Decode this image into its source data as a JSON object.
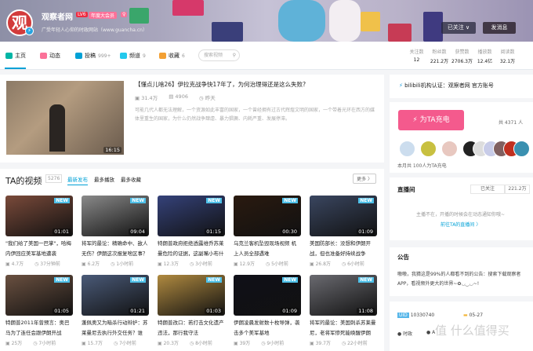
{
  "header": {
    "username": "观察者网",
    "level": "LV6",
    "vip": "年度大会员",
    "sex_badge": "♀",
    "signature": "广受年轻人心仰的时政网站（www.guancha.cn）",
    "follow_button": "已关注 ∨",
    "message_button": "发消息",
    "stats": [
      {
        "label": "关注数",
        "value": "12"
      },
      {
        "label": "粉丝数",
        "value": "221.2万"
      },
      {
        "label": "获赞数",
        "value": "2706.3万"
      },
      {
        "label": "播放数",
        "value": "12.4亿"
      },
      {
        "label": "阅读数",
        "value": "32.1万"
      }
    ]
  },
  "nav": {
    "items": [
      {
        "label": "主页",
        "count": "",
        "icon": "home-icon",
        "color": "#00b5a5"
      },
      {
        "label": "动态",
        "count": "",
        "icon": "dynamic-icon",
        "color": "#fb7299"
      },
      {
        "label": "投稿",
        "count": "999+",
        "icon": "video-icon",
        "color": "#00a1d6"
      },
      {
        "label": "频道",
        "count": "9",
        "icon": "channel-icon",
        "color": "#23c9ed"
      },
      {
        "label": "收藏",
        "count": "6",
        "icon": "favorite-icon",
        "color": "#f3a034"
      }
    ],
    "search_placeholder": "搜索视频"
  },
  "featured": {
    "title": "【懂点儿啥26】伊拉克战争快17年了，为何治理得还是这么失败?",
    "plays": "31.4万",
    "comments": "4906",
    "time": "昨天",
    "duration": "16:15",
    "description": "可能几代人都无法理解，一个资源如此丰富的国家，一个曾经拥有过古代辉煌文明的国家，一个带着光环在西方的媒体里重生的国家，为什么仍然战争肆虐、暴力猖獗、内耗严重、发展停滞。"
  },
  "videos": {
    "title": "TA的视频",
    "count": "5276",
    "tabs": [
      "最新发布",
      "最多播放",
      "最多收藏"
    ],
    "more": "更多 〉",
    "new_label": "NEW",
    "items": [
      {
        "title": "\"我们给了美国一巴掌\"，哈梅内伊回应美军基地遭袭",
        "plays": "4.7万",
        "time": "37分钟前",
        "duration": "01:01",
        "color": "#7a4a3a"
      },
      {
        "title": "将军的最论：精确命中、敌人无伤？伊朗这次报复啥区事？",
        "plays": "6.2万",
        "time": "1小时前",
        "duration": "09:04",
        "color": "#8a8a8a"
      },
      {
        "title": "特朗普政府拒绝透露维乔苏莱曼危险的证据，这副嘴小布什也",
        "plays": "12.3万",
        "time": "3小时前",
        "duration": "01:15",
        "color": "#35427a"
      },
      {
        "title": "乌克兰客机坠毁现场视频 机上人员全部遇难",
        "plays": "12.9万",
        "time": "5小时前",
        "duration": "00:30",
        "color": "#2a1a10"
      },
      {
        "title": "美国防部长：没想和伊朗开战，但也准备好持续战争",
        "plays": "26.8万",
        "time": "6小时前",
        "duration": "01:09",
        "color": "#3a4660"
      },
      {
        "title": "特朗普2011年曾预言：奥巴马为了连任会跟伊朗开战",
        "plays": "25万",
        "time": "7小时前",
        "duration": "01:05",
        "color": "#6a5040"
      },
      {
        "title": "蓬佩奥又为暗杀行动辩护：苏莱曼尼去执行外交任务？谁",
        "plays": "15.7万",
        "time": "7小时前",
        "duration": "01:21",
        "color": "#4a5a78"
      },
      {
        "title": "特朗普改口：若打击文化遗产违法，那行我守法",
        "plays": "20.3万",
        "time": "8小时前",
        "duration": "01:03",
        "color": "#b08a40"
      },
      {
        "title": "伊朗凌晨发射数十枚导弹，袭击多个美军基地",
        "plays": "39万",
        "time": "9小时前",
        "duration": "01:09",
        "color": "#101018"
      },
      {
        "title": "将军的最论：美国刺杀苏莱曼尼，老将军惨死能唤醒伊朗",
        "plays": "39.7万",
        "time": "22小时前",
        "duration": "11:08",
        "color": "#6a6a70"
      }
    ]
  },
  "sidebar": {
    "certification": "bilibili机构认证：观察者网 官方账号",
    "charge_button": "为TA充电",
    "charge_total": "共 4371 人",
    "charge_month": "本月共 100人为TA充电",
    "live": {
      "title": "直播间",
      "followed": "已关注",
      "fans": "221.2万",
      "offline": "主播不在，开播的时候会在动态通知你哦~",
      "link": "前往TA的直播间 〉"
    },
    "notice": {
      "title": "公告",
      "text": "嗷嗷，我猜这是99%的人都看不到的公告：搜索下载观察者APP，看视频外更大的世界~✿◡‿◡~!"
    },
    "info": {
      "uid_label": "UID",
      "uid": "10330740",
      "birthday": "05-27",
      "tags": [
        "时政",
        "A"
      ]
    }
  },
  "watermark": "值 什么值得买"
}
